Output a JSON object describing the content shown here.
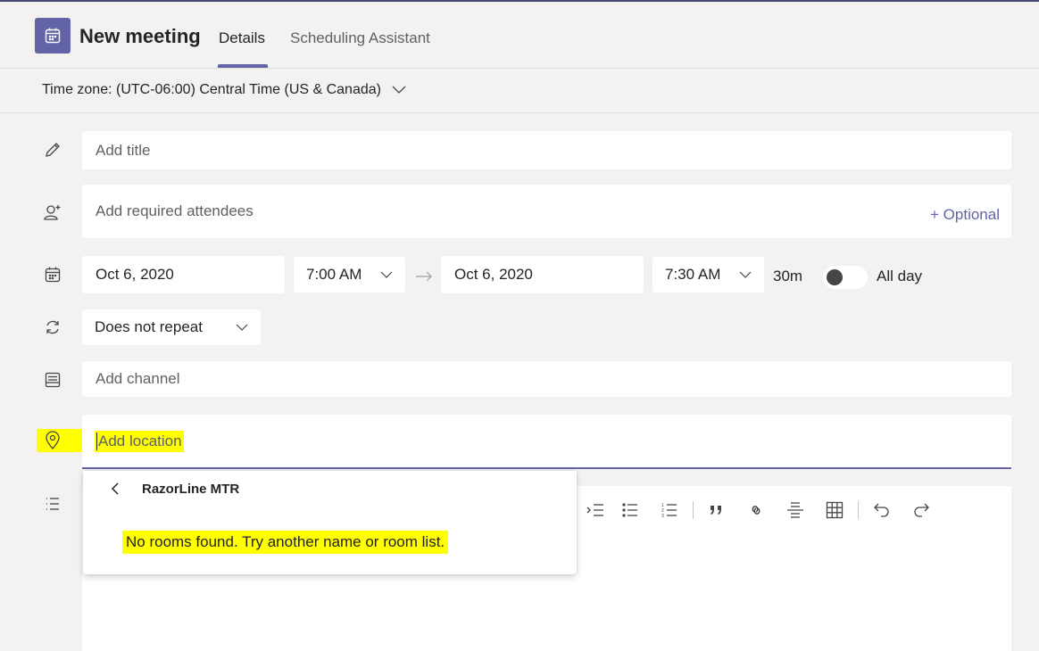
{
  "header": {
    "title": "New meeting",
    "tabs": [
      {
        "label": "Details",
        "active": true
      },
      {
        "label": "Scheduling Assistant",
        "active": false
      }
    ]
  },
  "timezone": {
    "label": "Time zone: (UTC-06:00) Central Time (US & Canada)"
  },
  "form": {
    "title_placeholder": "Add title",
    "attendees_placeholder": "Add required attendees",
    "optional_link": "+ Optional",
    "start_date": "Oct 6, 2020",
    "start_time": "7:00 AM",
    "end_date": "Oct 6, 2020",
    "end_time": "7:30 AM",
    "duration": "30m",
    "all_day_label": "All day",
    "all_day_on": false,
    "repeat": "Does not repeat",
    "channel_placeholder": "Add channel",
    "location_placeholder": "Add location"
  },
  "location_dropdown": {
    "list_name": "RazorLine MTR",
    "message": "No rooms found. Try another name or room list."
  },
  "colors": {
    "accent": "#6264a7",
    "highlight": "#ffff00",
    "background": "#f3f2f1"
  }
}
